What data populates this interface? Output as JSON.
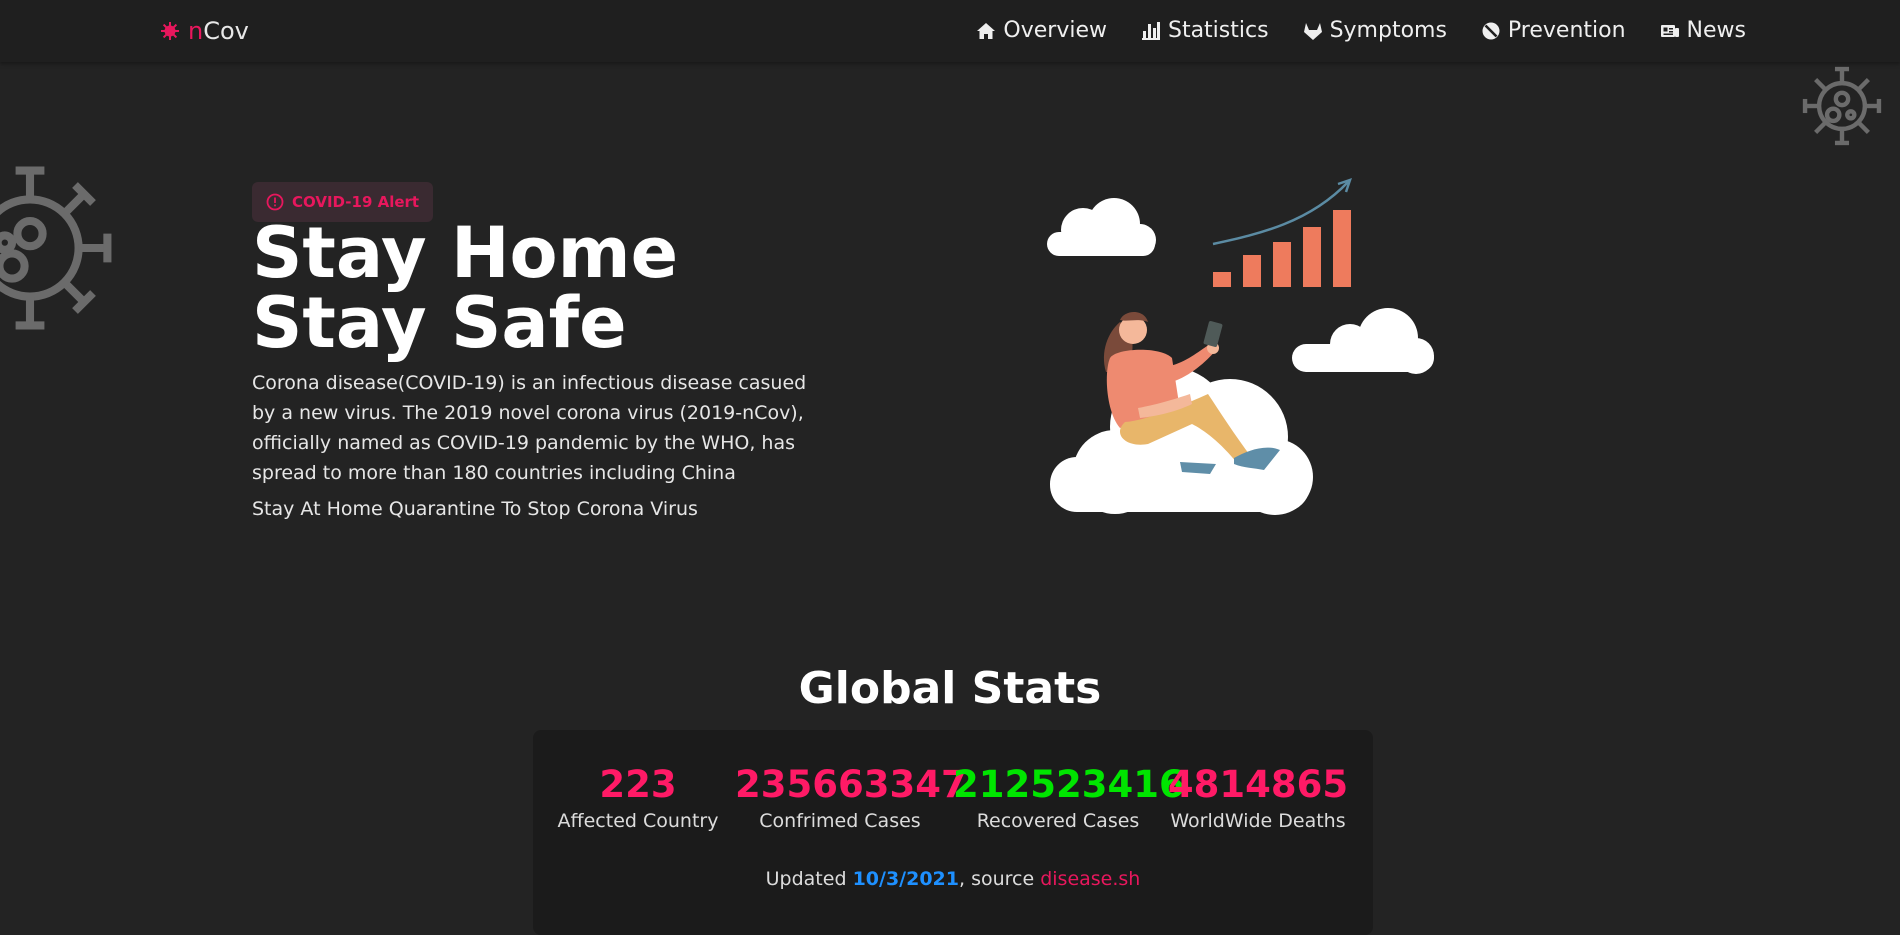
{
  "brand": {
    "prefix": "n",
    "suffix": "Cov",
    "icon": "virus-icon",
    "accent": "#e8175d"
  },
  "nav": [
    {
      "label": "Overview",
      "icon": "home-icon"
    },
    {
      "label": "Statistics",
      "icon": "bar-chart-icon"
    },
    {
      "label": "Symptoms",
      "icon": "gitlab-fox-icon"
    },
    {
      "label": "Prevention",
      "icon": "ban-icon"
    },
    {
      "label": "News",
      "icon": "newspaper-icon"
    }
  ],
  "hero": {
    "badge": "COVID-19 Alert",
    "title_line1": "Stay Home",
    "title_line2": "Stay Safe",
    "description": "Corona disease(COVID-19) is an infectious disease casued by a new virus. The 2019 novel corona virus (2019-nCov), officially named as COVID-19 pandemic by the WHO, has spread to more than 180 countries including China",
    "subtext": "Stay At Home Quarantine To Stop Corona Virus"
  },
  "stats": {
    "title": "Global Stats",
    "items": [
      {
        "value": "223",
        "label": "Affected Country",
        "color": "#ff1a66"
      },
      {
        "value": "235663347",
        "label": "Confrimed Cases",
        "color": "#ff1a66"
      },
      {
        "value": "212523416",
        "label": "Recovered Cases",
        "color": "#00e500"
      },
      {
        "value": "4814865",
        "label": "WorldWide Deaths",
        "color": "#ff1a66"
      }
    ],
    "updated_prefix": "Updated ",
    "updated_date": "10/3/2021",
    "updated_mid": ", source ",
    "source_link": "disease.sh"
  }
}
